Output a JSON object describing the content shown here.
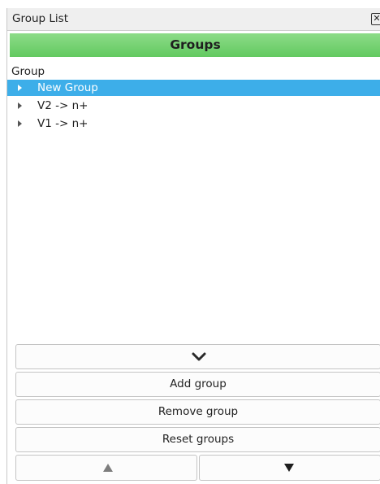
{
  "window": {
    "title": "Group List",
    "close_glyph": "✕"
  },
  "panel": {
    "header_title": "Groups",
    "column_header": "Group"
  },
  "tree": {
    "items": [
      {
        "label": "New Group",
        "selected": true
      },
      {
        "label": "V2 -> n+",
        "selected": false
      },
      {
        "label": "V1 -> n+",
        "selected": false
      }
    ]
  },
  "buttons": {
    "expand_icon": "chevron-down-icon",
    "add_label": "Add group",
    "remove_label": "Remove group",
    "reset_label": "Reset groups",
    "move_up_icon": "triangle-up-icon",
    "move_down_icon": "triangle-down-icon"
  },
  "colors": {
    "header_green": "#6ad166",
    "selection_blue": "#3daee9"
  }
}
